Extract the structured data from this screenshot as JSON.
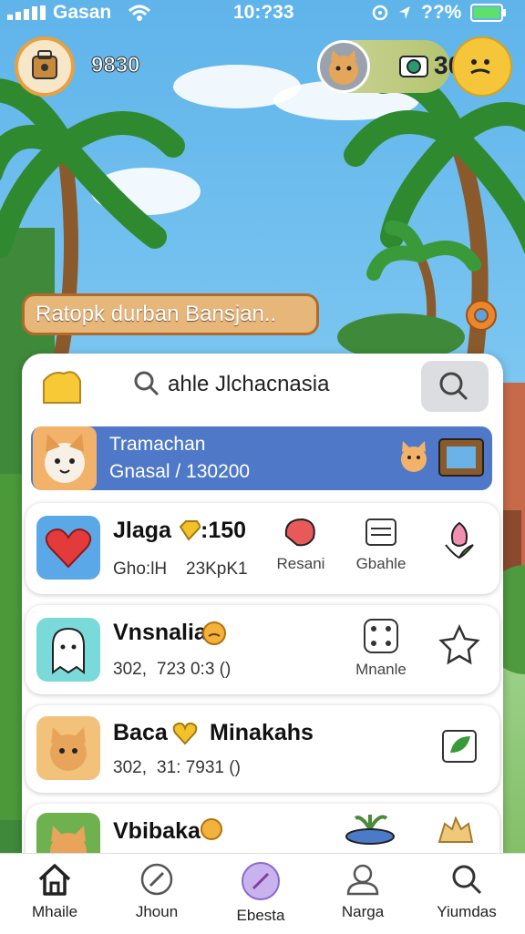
{
  "status_bar": {
    "carrier": "Gasan",
    "time": "10:?33",
    "battery": "??%"
  },
  "header": {
    "coins": "9830",
    "friend_score": "30"
  },
  "banner": {
    "text": "Ratopk durban Bansjan.."
  },
  "search": {
    "text": "ahle Jlchacnasia"
  },
  "featured": {
    "title": "Tramachan",
    "subtitle": "Gnasal / 130200"
  },
  "rows": [
    {
      "title": "Jlaga",
      "badge_value": ":150",
      "sub_left": "Gho:lH",
      "sub_right": "23KpK1",
      "actions": [
        {
          "icon": "steak-icon",
          "label": "Resani"
        },
        {
          "icon": "calendar-icon",
          "label": "Gbahle"
        },
        {
          "icon": "flower-icon",
          "label": ""
        }
      ]
    },
    {
      "title": "Vnsnalia:",
      "sub_left": "302,",
      "sub_right": "723 0:3 ()",
      "actions": [
        {
          "icon": "dice-icon",
          "label": "Mnanle"
        },
        {
          "icon": "star-icon",
          "label": ""
        }
      ]
    },
    {
      "title": "Baca",
      "title_right": "Minakahs",
      "sub_left": "302,",
      "sub_right": "31: 7931 ()",
      "actions": [
        {
          "icon": "leaf-card-icon",
          "label": ""
        }
      ]
    },
    {
      "title": "Vbibaka",
      "actions": []
    }
  ],
  "nav": [
    {
      "icon": "home-icon",
      "label": "Mhaile"
    },
    {
      "icon": "compass-icon",
      "label": "Jhoun"
    },
    {
      "icon": "brush-icon",
      "label": "Ebesta"
    },
    {
      "icon": "user-icon",
      "label": "Narga"
    },
    {
      "icon": "search-icon",
      "label": "Yiumdas"
    }
  ],
  "colors": {
    "sky": "#6bbdee",
    "featured": "#4f79c8",
    "coin_border": "#e9a03e",
    "banner": "#e7b77a"
  }
}
